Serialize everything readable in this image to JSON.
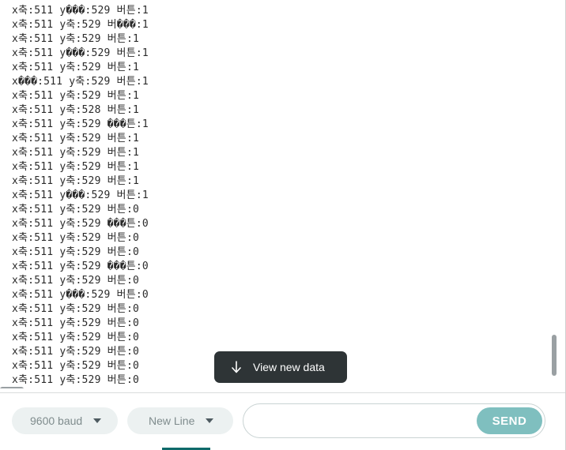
{
  "serial_log": {
    "lines": [
      "x축:511 y���:529 버튼:1",
      "x축:511 y축:529 버���:1",
      "x축:511 y축:529 버튼:1",
      "x축:511 y���:529 버튼:1",
      "x축:511 y축:529 버튼:1",
      "x���:511 y축:529 버튼:1",
      "x축:511 y축:529 버튼:1",
      "x축:511 y축:528 버튼:1",
      "x축:511 y축:529 ���튼:1",
      "x축:511 y축:529 버튼:1",
      "x축:511 y축:529 버튼:1",
      "x축:511 y축:529 버튼:1",
      "x축:511 y축:529 버튼:1",
      "x축:511 y���:529 버튼:1",
      "x축:511 y축:529 버튼:0",
      "x축:511 y축:529 ���튼:0",
      "x축:511 y축:529 버튼:0",
      "x축:511 y축:529 버튼:0",
      "x축:511 y축:529 ���튼:0",
      "x축:511 y축:529 버튼:0",
      "x축:511 y���:529 버튼:0",
      "x축:511 y축:529 버튼:0",
      "x축:511 y축:529 버튼:0",
      "x축:511 y축:529 버튼:0",
      "x축:511 y축:529 버튼:0",
      "x축:511 y축:529 버튼:0",
      "x축:511 y축:529 버튼:0"
    ]
  },
  "toast": {
    "label": "View new data",
    "icon": "arrow-down-icon"
  },
  "footer": {
    "baud": {
      "selected": "9600 baud"
    },
    "line_ending": {
      "selected": "New Line"
    },
    "message_input": {
      "value": "",
      "placeholder": ""
    },
    "send_label": "SEND"
  },
  "colors": {
    "send_button": "#7fbfbf",
    "toast_background": "#2e3436",
    "select_background": "#ecf1f1",
    "accent": "#0f6a6a"
  }
}
